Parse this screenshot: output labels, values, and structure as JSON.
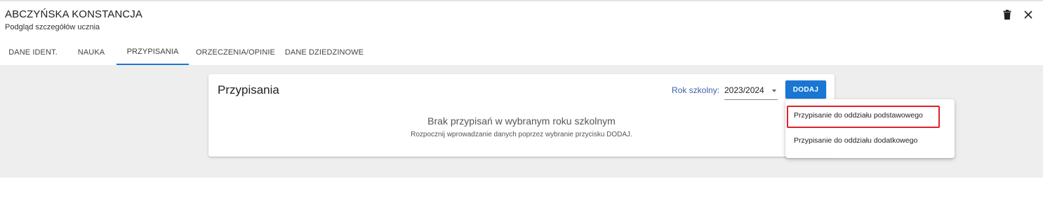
{
  "header": {
    "student_name": "ABCZYŃSKA KONSTANCJA",
    "subtitle": "Podgląd szczegółów ucznia",
    "icons": {
      "delete": "trash-icon",
      "close": "close-icon"
    }
  },
  "tabs": [
    {
      "label": "DANE IDENT.",
      "active": false
    },
    {
      "label": "NAUKA",
      "active": false
    },
    {
      "label": "PRZYPISANIA",
      "active": true
    },
    {
      "label": "ORZECZENIA/OPINIE",
      "active": false
    },
    {
      "label": "DANE DZIEDZINOWE",
      "active": false
    }
  ],
  "card": {
    "title": "Przypisania",
    "school_year_label": "Rok szkolny:",
    "school_year_value": "2023/2024",
    "add_button": "DODAJ",
    "empty_title": "Brak przypisań w wybranym roku szkolnym",
    "empty_description": "Rozpocznij wprowadzanie danych poprzez wybranie przycisku DODAJ."
  },
  "menu": {
    "items": [
      {
        "label": "Przypisanie do oddziału podstawowego",
        "highlighted": true
      },
      {
        "label": "Przypisanie do oddziału dodatkowego",
        "highlighted": false
      }
    ]
  },
  "colors": {
    "accent": "#1976d2",
    "highlight_border": "#e0202a",
    "background_gray": "#eeeeee",
    "year_label": "#3f5fa8"
  }
}
